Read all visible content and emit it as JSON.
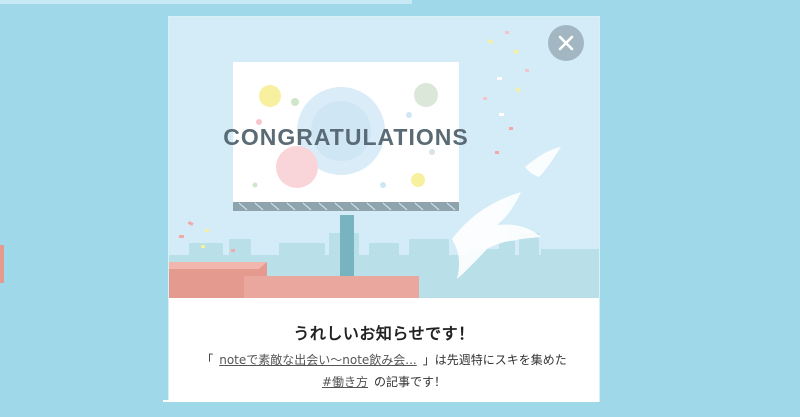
{
  "modal": {
    "billboard_text": "CONGRATULATIONS",
    "close_icon": "close-icon",
    "title": "うれしいお知らせです！",
    "line1_open": "「",
    "article_link": "noteで素敵な出会い〜note飲み会...",
    "line1_close": "」は先週特にスキを集めた",
    "hashtag_link": "#働き方",
    "line2_suffix": "の記事です！"
  },
  "colors": {
    "backdrop": "#9fd8e9",
    "hero_sky": "#d4ecf7",
    "billboard_text": "#5a6b75",
    "building_red": "#e59a8f"
  }
}
